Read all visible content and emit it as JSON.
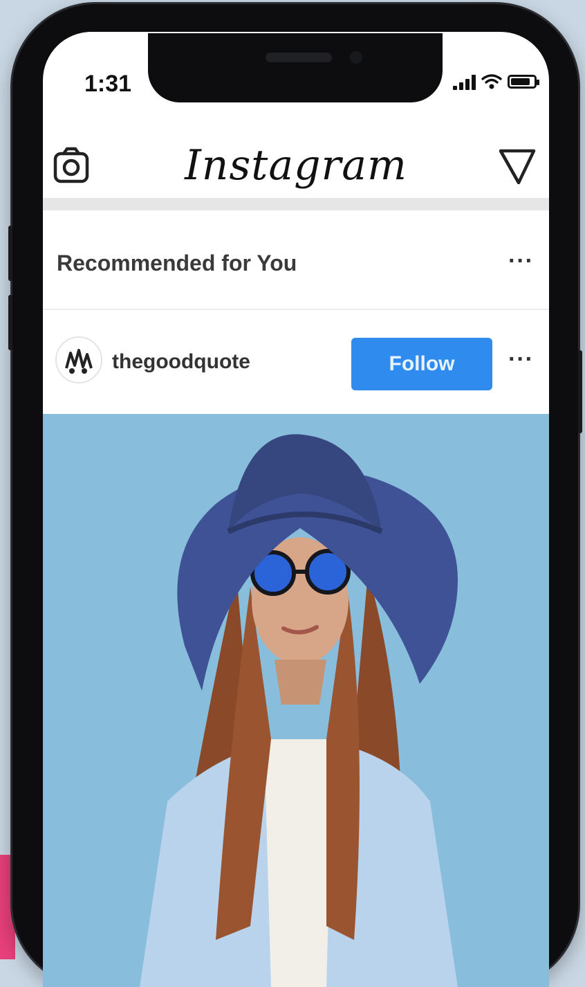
{
  "status_bar": {
    "time": "1:31",
    "battery_level": 0.85
  },
  "nav": {
    "title": "Instagram",
    "left_icon": "camera-icon",
    "right_icon": "send-icon"
  },
  "recommended": {
    "title": "Recommended for You",
    "more": "···"
  },
  "profile": {
    "username": "thegoodquote",
    "follow_label": "Follow",
    "more": "···"
  },
  "colors": {
    "follow_button": "#2f8cee",
    "post_background": "#88bddb",
    "accent_pink": "#e8407a"
  }
}
